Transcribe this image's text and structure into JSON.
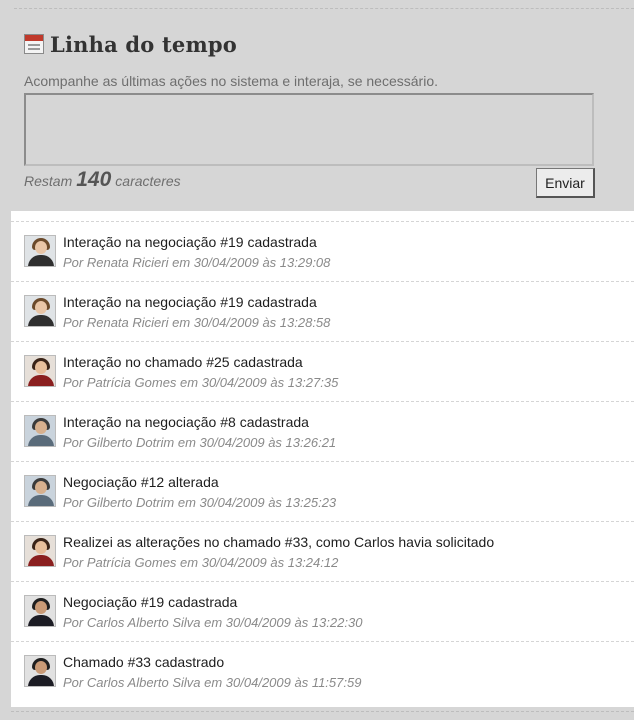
{
  "header": {
    "title": "Linha do tempo",
    "icon": "calendar-icon"
  },
  "composer": {
    "subtitle": "Acompanhe as últimas ações no sistema e interaja, se necessário.",
    "textarea_value": "",
    "counter_prefix": "Restam",
    "counter_value": "140",
    "counter_suffix": "caracteres",
    "send_label": "Enviar"
  },
  "timeline": {
    "items": [
      {
        "title": "Interação na negociação #19 cadastrada",
        "meta": "Por Renata Ricieri em 30/04/2009 às 13:29:08",
        "avatar": "renata"
      },
      {
        "title": "Interação na negociação #19 cadastrada",
        "meta": "Por Renata Ricieri em 30/04/2009 às 13:28:58",
        "avatar": "renata"
      },
      {
        "title": "Interação no chamado #25 cadastrada",
        "meta": "Por Patrícia Gomes em 30/04/2009 às 13:27:35",
        "avatar": "patricia"
      },
      {
        "title": "Interação na negociação #8 cadastrada",
        "meta": "Por Gilberto Dotrim em 30/04/2009 às 13:26:21",
        "avatar": "gilberto"
      },
      {
        "title": "Negociação #12 alterada",
        "meta": "Por Gilberto Dotrim em 30/04/2009 às 13:25:23",
        "avatar": "gilberto"
      },
      {
        "title": "Realizei as alterações no chamado #33, como Carlos havia solicitado",
        "meta": "Por Patrícia Gomes em 30/04/2009 às 13:24:12",
        "avatar": "patricia"
      },
      {
        "title": "Negociação #19 cadastrada",
        "meta": "Por Carlos Alberto Silva em 30/04/2009 às 13:22:30",
        "avatar": "carlos"
      },
      {
        "title": "Chamado #33 cadastrado",
        "meta": "Por Carlos Alberto Silva em 30/04/2009 às 11:57:59",
        "avatar": "carlos"
      }
    ]
  },
  "colors": {
    "page_bg": "#d6d6d6",
    "panel_bg": "#ffffff",
    "title_text": "#1e1e1e",
    "meta_text": "#8a8a8a"
  }
}
